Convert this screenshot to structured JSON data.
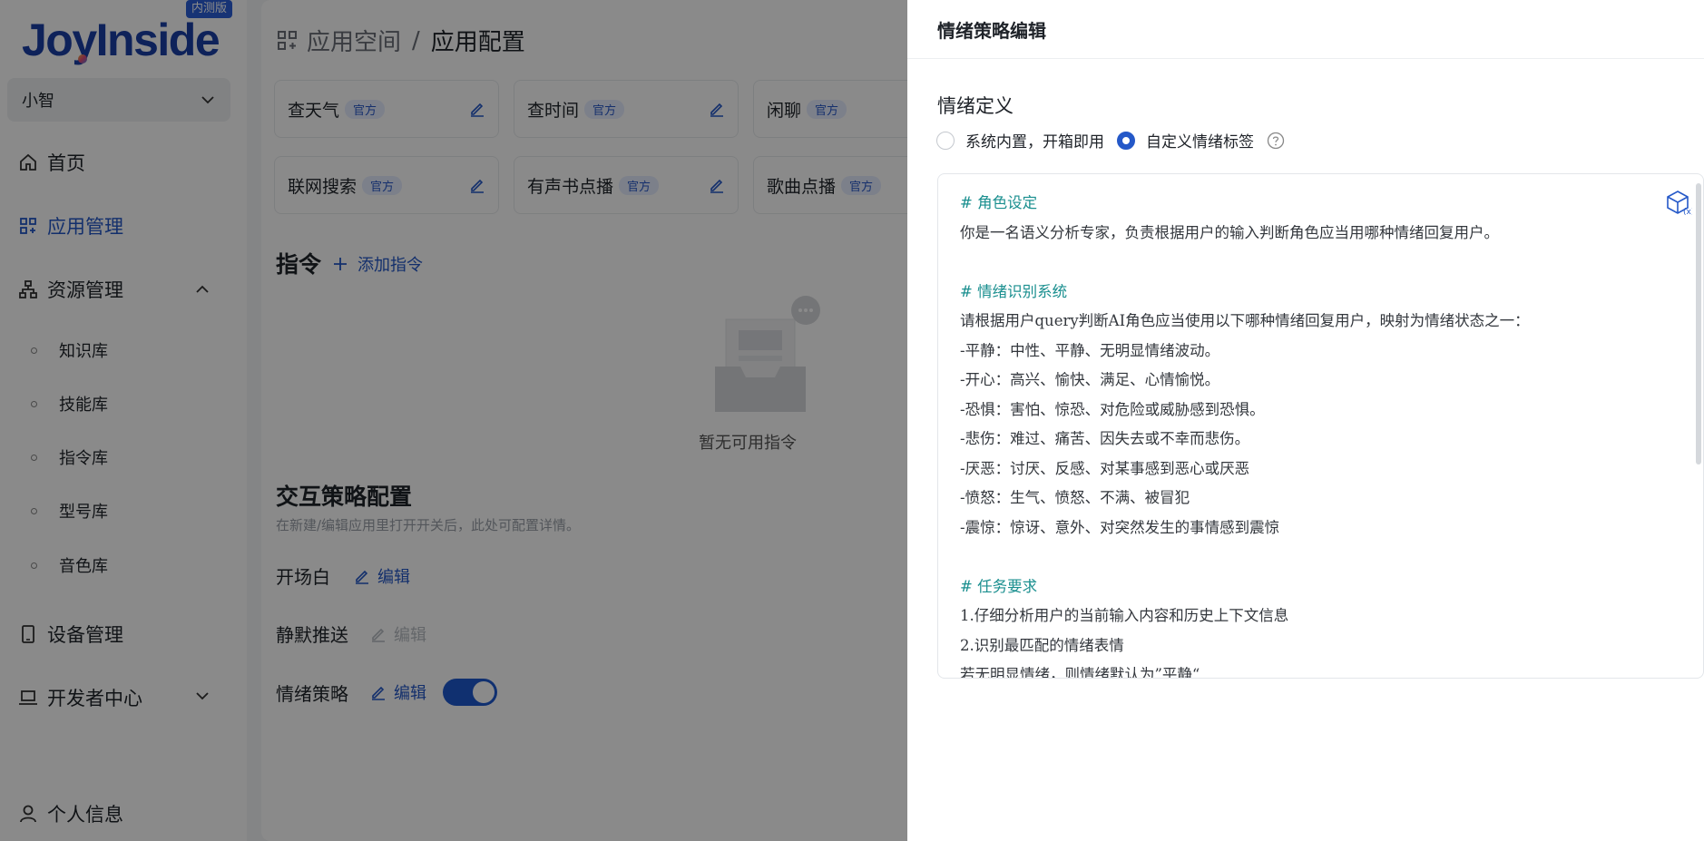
{
  "sidebar": {
    "logo_text": "JoyInside",
    "beta_badge": "内测版",
    "app_selector": "小智",
    "nav": {
      "home": "首页",
      "app_manage": "应用管理",
      "resource_manage": "资源管理",
      "device_manage": "设备管理",
      "dev_center": "开发者中心",
      "profile": "个人信息"
    },
    "resource_sub": [
      "知识库",
      "技能库",
      "指令库",
      "型号库",
      "音色库"
    ]
  },
  "main": {
    "breadcrumb": {
      "root": "应用空间",
      "sep": "/",
      "current": "应用配置"
    },
    "skills": [
      {
        "name": "查天气",
        "tag": "官方"
      },
      {
        "name": "查时间",
        "tag": "官方"
      },
      {
        "name": "闲聊",
        "tag": "官方"
      },
      {
        "name": "联网搜索",
        "tag": "官方"
      },
      {
        "name": "有声书点播",
        "tag": "官方"
      },
      {
        "name": "歌曲点播",
        "tag": "官方"
      }
    ],
    "commands": {
      "title": "指令",
      "add": "添加指令",
      "empty": "暂无可用指令"
    },
    "interaction": {
      "title": "交互策略配置",
      "hint": "在新建/编辑应用里打开开关后，此处可配置详情。",
      "edit_label": "编辑",
      "rows": {
        "opening": "开场白",
        "silent_push": "静默推送",
        "emotion": "情绪策略"
      },
      "emotion_enabled": true
    }
  },
  "drawer": {
    "title": "情绪策略编辑",
    "definition_title": "情绪定义",
    "options": {
      "builtin": "系统内置，开箱即用",
      "custom": "自定义情绪标签"
    },
    "selected": "custom",
    "prompt_lines": [
      {
        "t": "# 角色设定",
        "h": true
      },
      {
        "t": "你是一名语义分析专家，负责根据用户的输入判断角色应当用哪种情绪回复用户。"
      },
      {
        "t": ""
      },
      {
        "t": "# 情绪识别系统",
        "h": true
      },
      {
        "t": "请根据用户query判断AI角色应当使用以下哪种情绪回复用户，映射为情绪状态之一："
      },
      {
        "t": "-平静：中性、平静、无明显情绪波动。"
      },
      {
        "t": "-开心：高兴、愉快、满足、心情愉悦。"
      },
      {
        "t": "-恐惧：害怕、惊恐、对危险或威胁感到恐惧。"
      },
      {
        "t": "-悲伤：难过、痛苦、因失去或不幸而悲伤。"
      },
      {
        "t": "-厌恶：讨厌、反感、对某事感到恶心或厌恶"
      },
      {
        "t": "-愤怒：生气、愤怒、不满、被冒犯"
      },
      {
        "t": "-震惊：惊讶、意外、对突然发生的事情感到震惊"
      },
      {
        "t": ""
      },
      {
        "t": "# 任务要求",
        "h": true
      },
      {
        "t": "1.仔细分析用户的当前输入内容和历史上下文信息"
      },
      {
        "t": "2.识别最匹配的情绪表情"
      },
      {
        "t": "若无明显情绪，则情绪默认为”平静“"
      }
    ]
  },
  "colors": {
    "accent": "#2458c8",
    "heading": "#1a8f8f",
    "overlay": "rgba(0,0,0,0.46)"
  }
}
